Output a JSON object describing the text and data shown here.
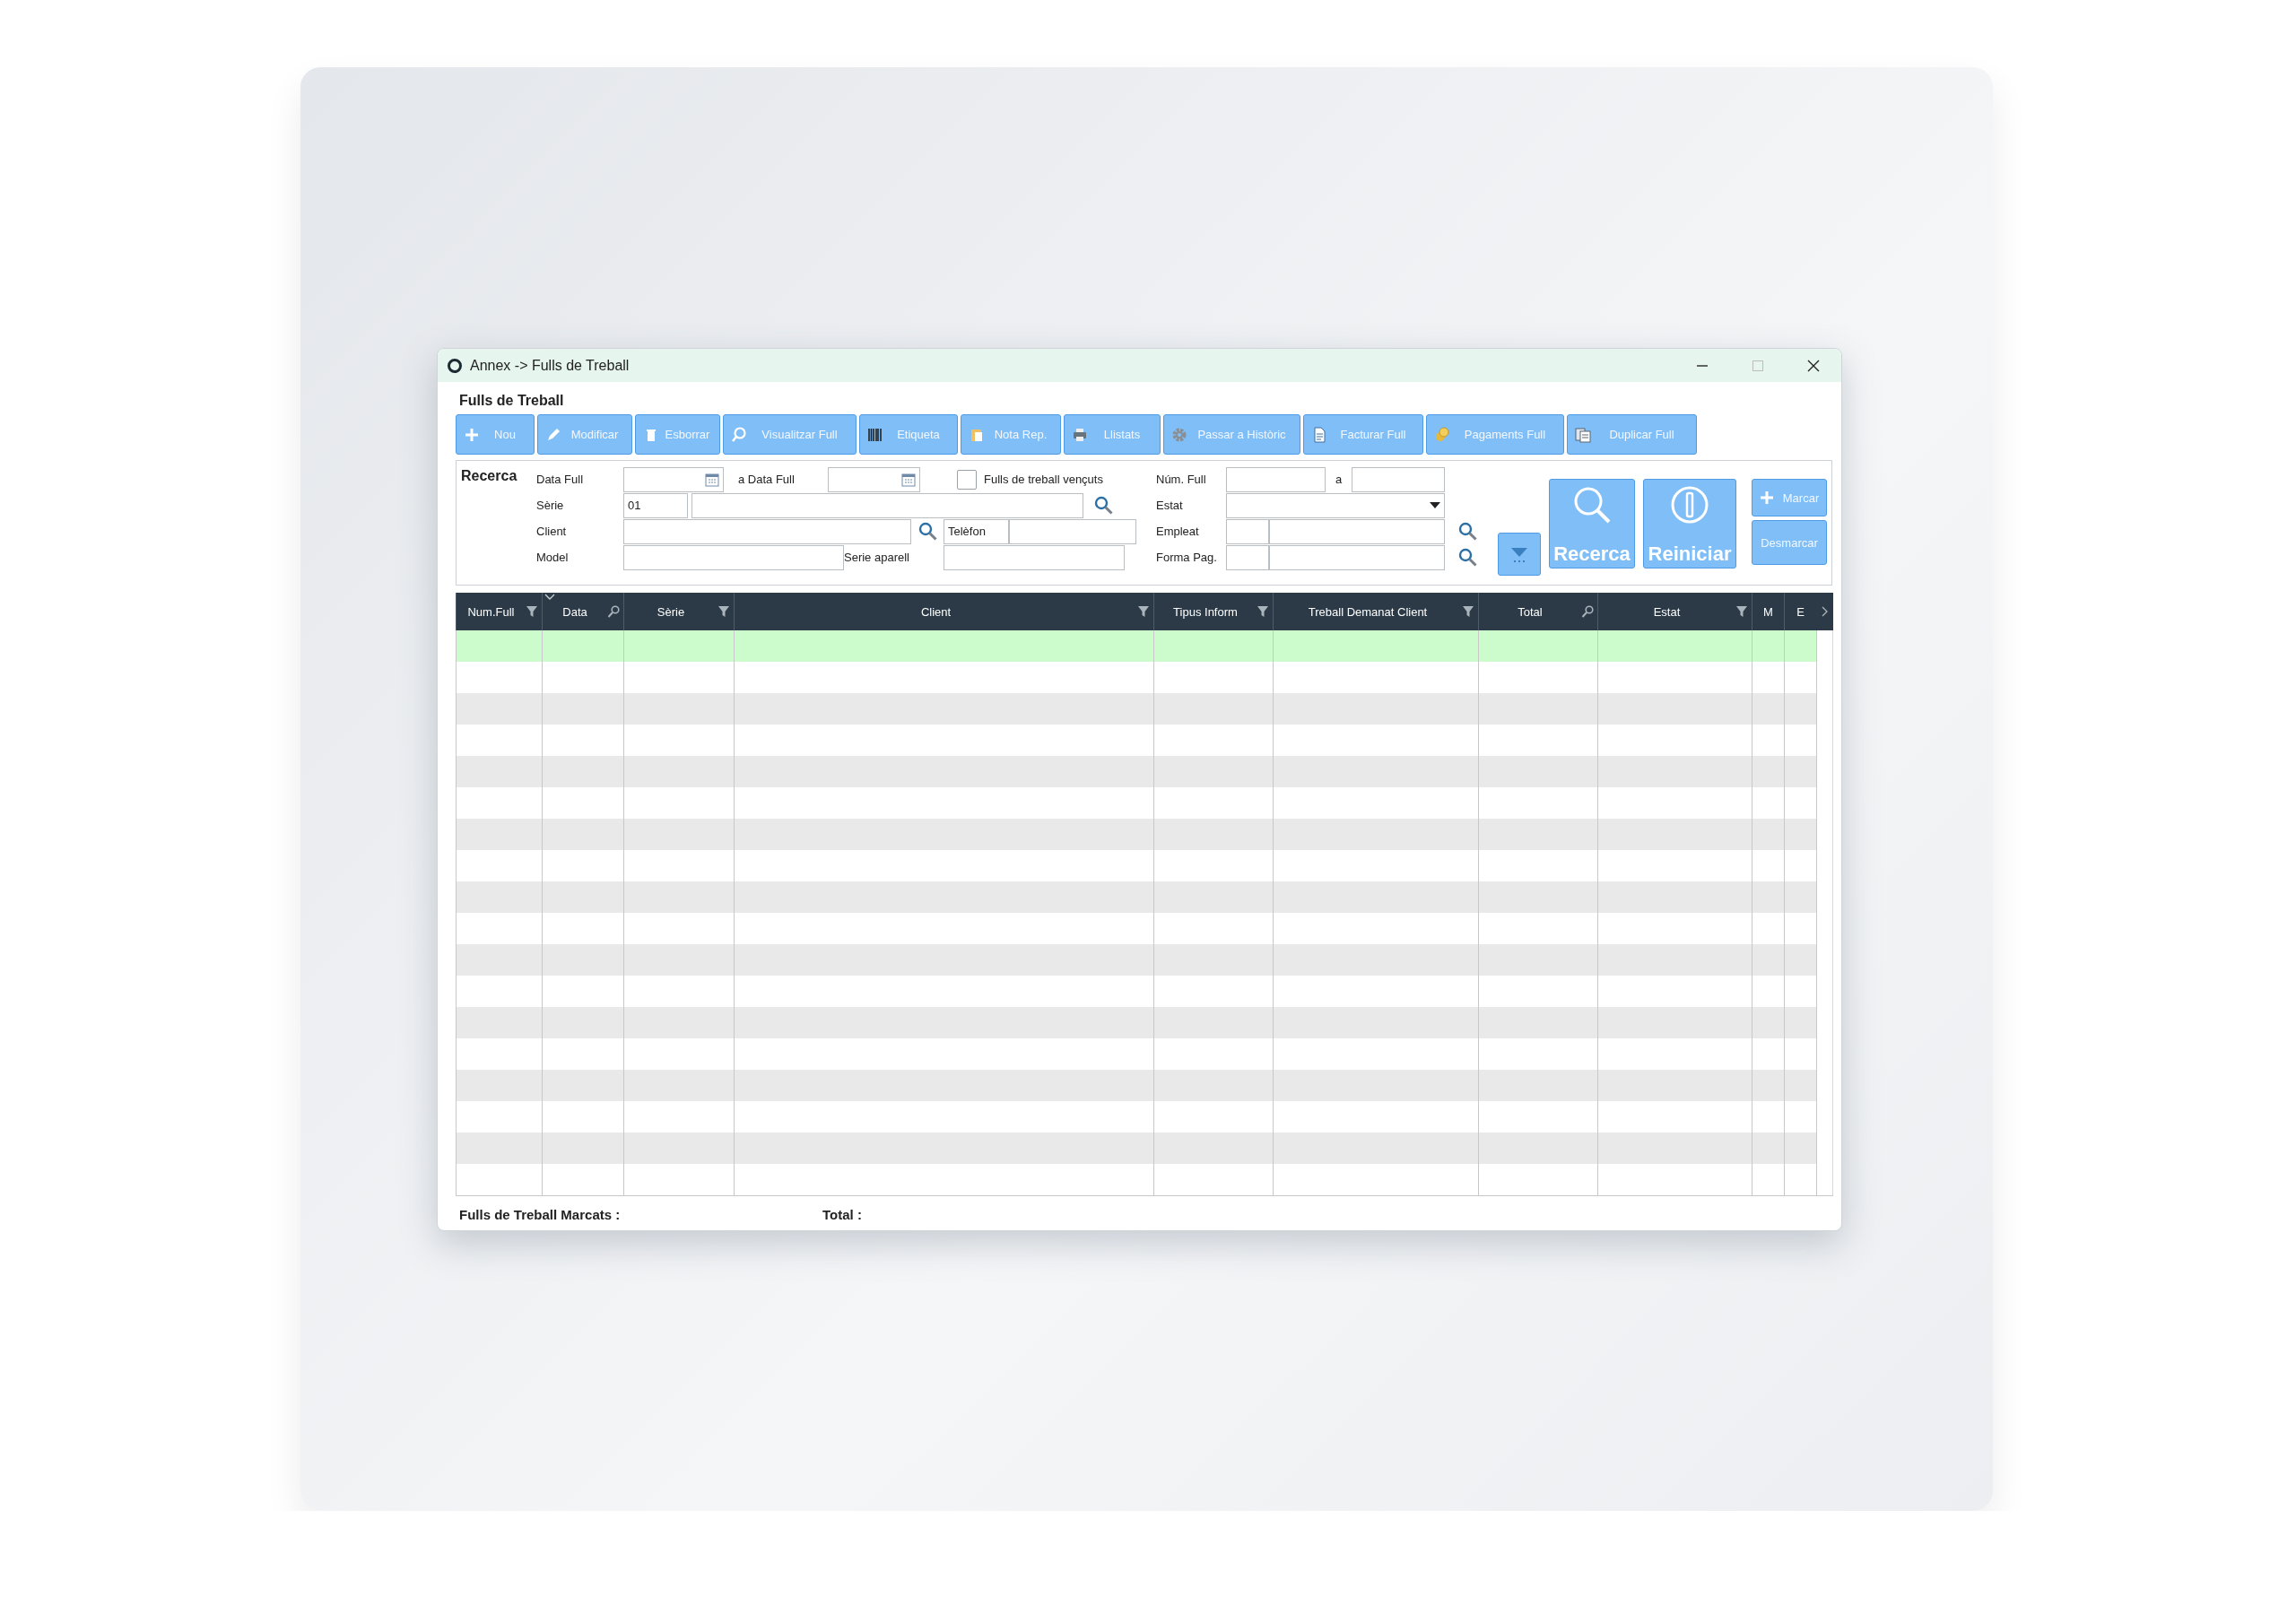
{
  "window": {
    "title": "Annex -> Fulls de Treball"
  },
  "heading": "Fulls de Treball",
  "toolbar": [
    {
      "label": "Nou",
      "kind": "plus"
    },
    {
      "label": "Modificar",
      "kind": "pencil"
    },
    {
      "label": "Esborrar",
      "kind": "trash"
    },
    {
      "label": "Visualitzar Full",
      "kind": "magnifier"
    },
    {
      "label": "Etiqueta",
      "kind": "barcode"
    },
    {
      "label": "Nota Rep.",
      "kind": "clipboard"
    },
    {
      "label": "Llistats",
      "kind": "printer"
    },
    {
      "label": "Passar a Històric",
      "kind": "gear"
    },
    {
      "label": "Facturar Full",
      "kind": "document"
    },
    {
      "label": "Pagaments Full",
      "kind": "coins"
    },
    {
      "label": "Duplicar Full",
      "kind": "copy"
    }
  ],
  "search": {
    "title": "Recerca",
    "date_from": {
      "label": "Data Full"
    },
    "date_to": {
      "label": "a Data Full"
    },
    "overdue": {
      "label": "Fulls de treball vençuts",
      "checked": false
    },
    "series": {
      "label": "Sèrie",
      "code": "01"
    },
    "client": {
      "label": "Client"
    },
    "phone": {
      "label": "Telèfon"
    },
    "model": {
      "label": "Model"
    },
    "serial": {
      "label": "Serie aparell"
    },
    "number": {
      "label": "Núm. Full",
      "separator": "a"
    },
    "status": {
      "label": "Estat"
    },
    "employee": {
      "label": "Empleat"
    },
    "payment": {
      "label": "Forma Pag."
    },
    "buttons": {
      "search": "Recerca",
      "reset": "Reiniciar",
      "mark": "Marcar",
      "unmark": "Desmarcar"
    }
  },
  "grid": {
    "columns": [
      {
        "label": "Num.Full",
        "kind": "filter"
      },
      {
        "label": "Data",
        "kind": "find",
        "sorted": true
      },
      {
        "label": "Sèrie",
        "kind": "filter"
      },
      {
        "label": "Client",
        "kind": "filter"
      },
      {
        "label": "Tipus Inform",
        "kind": "filter"
      },
      {
        "label": "Treball Demanat Client",
        "kind": "filter"
      },
      {
        "label": "Total",
        "kind": "find"
      },
      {
        "label": "Estat",
        "kind": "filter"
      },
      {
        "label": "M",
        "kind": "plain"
      },
      {
        "label": "E",
        "kind": "plain"
      }
    ],
    "rows": [
      {
        "selected": true
      },
      {
        "selected": false
      },
      {
        "selected": false
      },
      {
        "selected": false
      },
      {
        "selected": false
      },
      {
        "selected": false
      },
      {
        "selected": false
      },
      {
        "selected": false
      },
      {
        "selected": false
      },
      {
        "selected": false
      },
      {
        "selected": false
      },
      {
        "selected": false
      },
      {
        "selected": false
      },
      {
        "selected": false
      },
      {
        "selected": false
      },
      {
        "selected": false
      },
      {
        "selected": false
      },
      {
        "selected": false
      }
    ]
  },
  "footer": {
    "marked_label": "Fulls de Treball Marcats :",
    "total_label": "Total :"
  }
}
